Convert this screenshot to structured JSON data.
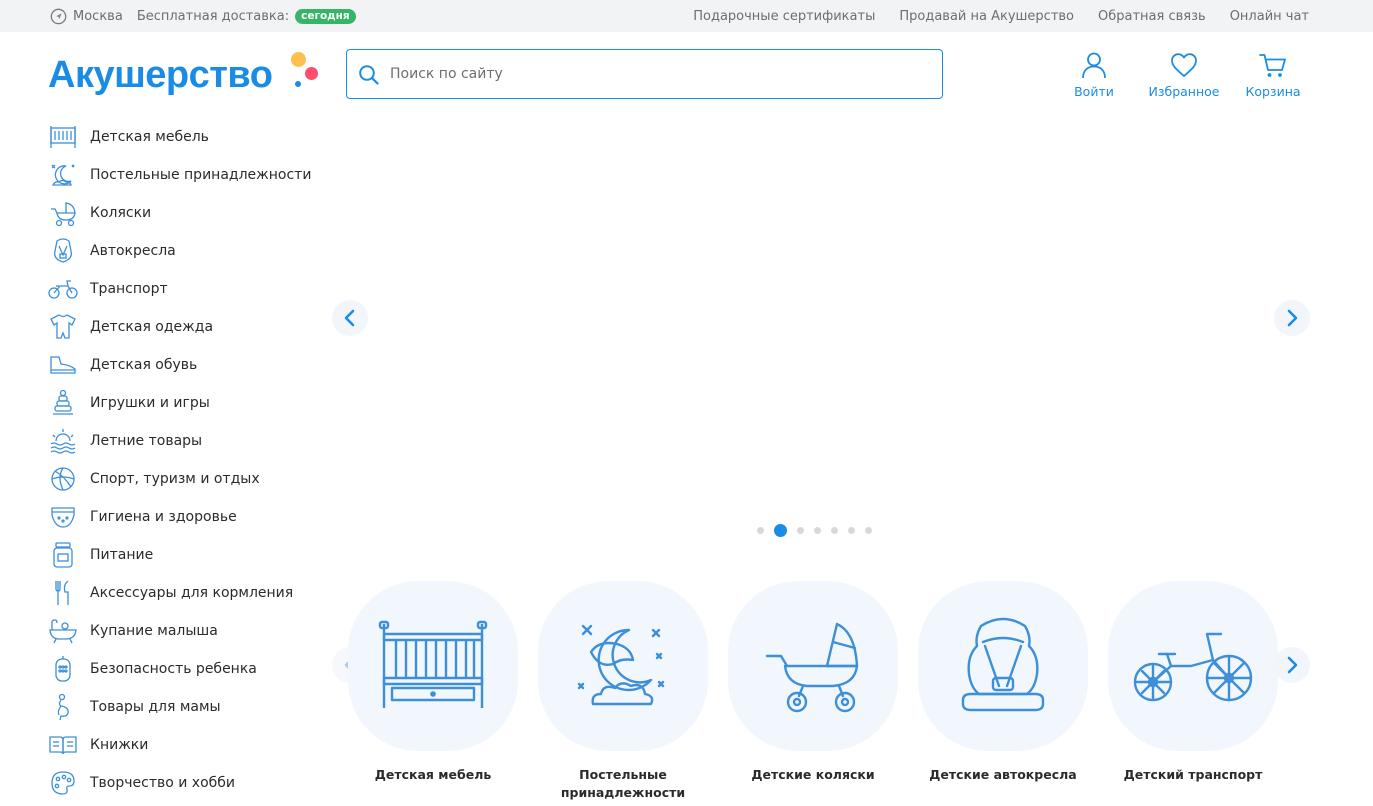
{
  "topbar": {
    "city": "Москва",
    "delivery_label": "Бесплатная доставка:",
    "delivery_badge": "сегодня",
    "links": [
      "Подарочные сертификаты",
      "Продавай на Акушерство",
      "Обратная связь",
      "Онлайн чат"
    ]
  },
  "header": {
    "logo_text": "Акушерство",
    "search_placeholder": "Поиск по сайту",
    "actions": {
      "login": "Войти",
      "favorites": "Избранное",
      "cart": "Корзина"
    }
  },
  "sidebar": {
    "items": [
      {
        "label": "Детская мебель",
        "icon": "crib-icon"
      },
      {
        "label": "Постельные принадлежности",
        "icon": "bedding-icon"
      },
      {
        "label": "Коляски",
        "icon": "stroller-icon"
      },
      {
        "label": "Автокресла",
        "icon": "car-seat-icon"
      },
      {
        "label": "Транспорт",
        "icon": "bicycle-icon"
      },
      {
        "label": "Детская одежда",
        "icon": "romper-icon"
      },
      {
        "label": "Детская обувь",
        "icon": "shoe-icon"
      },
      {
        "label": "Игрушки и игры",
        "icon": "pyramid-toy-icon"
      },
      {
        "label": "Летние товары",
        "icon": "sun-waves-icon"
      },
      {
        "label": "Спорт, туризм и отдых",
        "icon": "ball-icon"
      },
      {
        "label": "Гигиена и здоровье",
        "icon": "diaper-icon"
      },
      {
        "label": "Питание",
        "icon": "baby-food-jar-icon"
      },
      {
        "label": "Аксессуары для кормления",
        "icon": "cutlery-icon"
      },
      {
        "label": "Купание малыша",
        "icon": "bathtub-icon"
      },
      {
        "label": "Безопасность ребенка",
        "icon": "baby-monitor-icon"
      },
      {
        "label": "Товары для мамы",
        "icon": "pregnant-icon"
      },
      {
        "label": "Книжки",
        "icon": "book-icon"
      },
      {
        "label": "Творчество и хобби",
        "icon": "palette-icon"
      }
    ]
  },
  "slider": {
    "slide_count": 7,
    "active_index": 1
  },
  "categories": [
    {
      "label": "Детская мебель",
      "icon": "crib-icon"
    },
    {
      "label": "Постельные принадлежности",
      "icon": "bedding-icon"
    },
    {
      "label": "Детские коляски",
      "icon": "stroller-icon"
    },
    {
      "label": "Детские автокресла",
      "icon": "car-seat-icon"
    },
    {
      "label": "Детский транспорт",
      "icon": "bicycle-icon"
    }
  ],
  "colors": {
    "brand_blue": "#1a8ce5",
    "badge_green": "#35b666",
    "topbar_bg": "#f2f3f5",
    "tile_bg": "#f2f7fd",
    "logo_dot_yellow": "#ffc04d",
    "logo_dot_red": "#ff4d6a",
    "logo_dot_blue": "#1a8ce5"
  }
}
